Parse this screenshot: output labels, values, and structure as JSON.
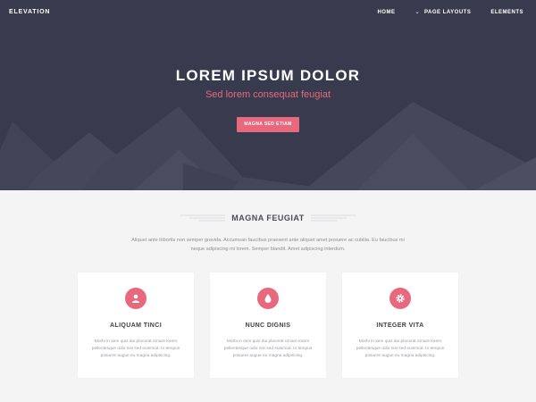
{
  "header": {
    "logo": "ELEVATION",
    "nav": [
      "HOME",
      "PAGE LAYOUTS",
      "ELEMENTS"
    ]
  },
  "hero": {
    "title": "LOREM IPSUM DOLOR",
    "subtitle": "Sed lorem consequat feugiat",
    "button": "MAGNA SED ETIAM"
  },
  "section": {
    "title": "MAGNA FEUGIAT",
    "description": "Aliquet ante lobortis non semper gravida. Accumsan faucibus praesent ante aliquet amet posuere ac cubilia. Eu faucibus mi neque adipiscing mi lorem. Semper blandit. Amet adipiscing interdum."
  },
  "features": [
    {
      "icon": "user-icon",
      "title": "ALIQUAM TINCI",
      "text": "Morbi in sem quis dui placerat ornare lorem pellentesque odio nisi sed euismod. In tempus posuere augue eu magna adipiscing."
    },
    {
      "icon": "drop-icon",
      "title": "NUNC DIGNIS",
      "text": "Morbi in sem quis dui placerat ornare lorem pellentesque odio nisi sed euismod. In tempus posuere augue eu magna adipiscing."
    },
    {
      "icon": "gear-icon",
      "title": "INTEGER VITA",
      "text": "Morbi in sem quis dui placerat ornare lorem pellentesque odio nisi sed euismod. In tempus posuere augue eu magna adipiscing."
    }
  ],
  "colors": {
    "hero_bg": "#383a4e",
    "accent": "#e8697d",
    "page_bg": "#f4f4f4"
  }
}
